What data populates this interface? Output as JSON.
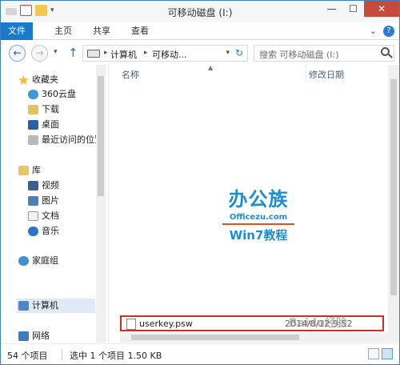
{
  "window": {
    "title": "可移动磁盘 (I:)",
    "min_glyph": "—",
    "max_glyph": "☐",
    "close_glyph": "✕"
  },
  "ribbon": {
    "tabs": [
      "文件",
      "主页",
      "共享",
      "查看"
    ],
    "expand_glyph": "⌄",
    "help_glyph": "?"
  },
  "nav": {
    "back_glyph": "←",
    "forward_glyph": "→",
    "recent_glyph": "▾",
    "up_glyph": "↑",
    "address_segments": [
      "计算机",
      "可移动..."
    ],
    "address_arrow": "▸",
    "refresh_glyph": "↻",
    "search_placeholder": "搜索 可移动磁盘 (I:)"
  },
  "sidebar": {
    "favorites_label": "收藏夹",
    "favorites": [
      {
        "label": "360云盘",
        "icon": "cloud-icon"
      },
      {
        "label": "下载",
        "icon": "download-folder-icon"
      },
      {
        "label": "桌面",
        "icon": "desktop-icon"
      },
      {
        "label": "最近访问的位置",
        "icon": "recent-places-icon"
      }
    ],
    "libraries_label": "库",
    "libraries": [
      {
        "label": "视频",
        "icon": "video-library-icon"
      },
      {
        "label": "图片",
        "icon": "pictures-library-icon"
      },
      {
        "label": "文档",
        "icon": "documents-library-icon"
      },
      {
        "label": "音乐",
        "icon": "music-library-icon"
      }
    ],
    "homegroup_label": "家庭组",
    "computer_label": "计算机",
    "network_label": "网络"
  },
  "files": {
    "columns": [
      "名称",
      "修改日期"
    ],
    "items": [
      {
        "name": "userkey.psw",
        "modified": "2014/8/12 9:52",
        "selected": true
      }
    ]
  },
  "logo": {
    "line1": "办公族",
    "line2": "Officezu.com",
    "line3": "Win7教程"
  },
  "status": {
    "count": "54 个项目",
    "selection": "选中 1 个项目  1.50 KB"
  },
  "watermark": "Baidu经验",
  "colors": {
    "accent": "#1979ca",
    "close": "#c74b3b",
    "highlight_border": "#d02c2c"
  }
}
